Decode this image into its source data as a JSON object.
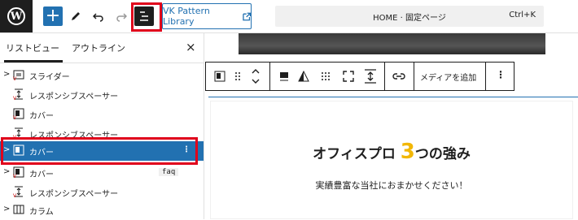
{
  "header": {
    "logo": "W",
    "add_icon": "plus-icon",
    "edit_icon": "pencil-icon",
    "undo_icon": "undo-icon",
    "redo_icon": "redo-icon",
    "list_view_icon": "list-view-icon",
    "vk_button": "VK Pattern Library",
    "command": {
      "title": "HOME · 固定ページ",
      "shortcut": "Ctrl+K"
    }
  },
  "sidebar": {
    "tabs": [
      "リストビュー",
      "アウトライン"
    ],
    "close": "×",
    "items": [
      {
        "label": "スライダー",
        "chevron": ">",
        "icon": "slider-icon"
      },
      {
        "label": "レスポンシブスペーサー",
        "icon": "spacer-icon"
      },
      {
        "label": "カバー",
        "icon": "cover-icon"
      },
      {
        "label": "レスポンシブスペーサー",
        "icon": "spacer-icon"
      },
      {
        "label": "カバー",
        "chevron": ">",
        "icon": "cover-icon",
        "selected": true,
        "more": "⋮"
      },
      {
        "label": "カバー",
        "chevron": ">",
        "icon": "cover-icon",
        "badge": "faq"
      },
      {
        "label": "レスポンシブスペーサー",
        "icon": "spacer-icon"
      },
      {
        "label": "カラム",
        "chevron": ">",
        "icon": "columns-icon"
      }
    ]
  },
  "block_toolbar": {
    "media_button": "メディアを追加",
    "more": "⋮"
  },
  "content": {
    "heading_prefix": "オフィスプロ",
    "heading_number": "3",
    "heading_suffix": "つの強み",
    "subtitle": "実績豊富な当社におまかせください！"
  },
  "colors": {
    "accent": "#2271b1",
    "highlight_red": "#e0001b",
    "number_yellow": "#f2b705"
  }
}
